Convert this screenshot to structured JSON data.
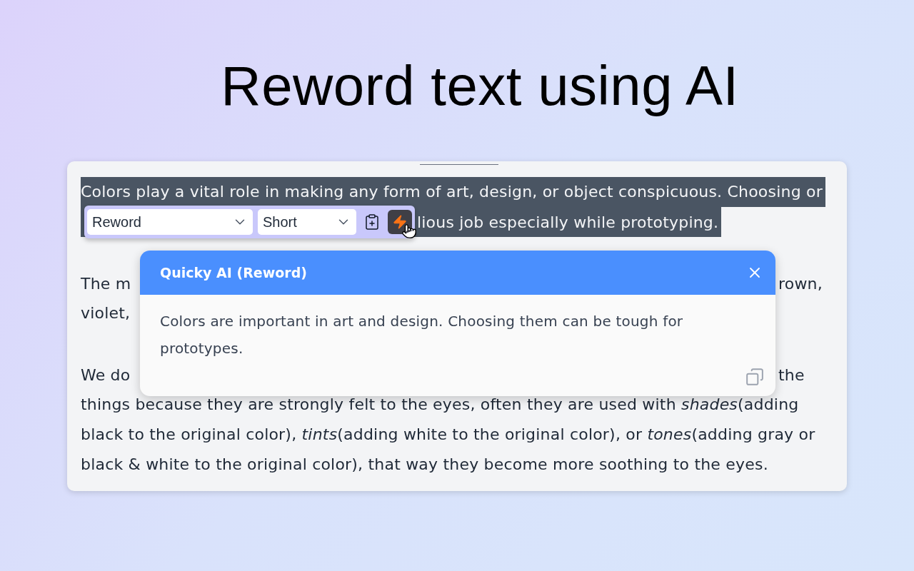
{
  "heading": "Reword text using AI",
  "editor": {
    "paragraphs": [
      {
        "selected": true,
        "lines": [
          {
            "left": "Colors play a vital role in making any form of art, design, or object conspicuous. Choosing or"
          },
          {
            "right": "lious job especially while prototyping."
          }
        ]
      },
      {
        "selected": false,
        "lines": [
          {
            "left": "The m",
            "right": "rown,"
          },
          {
            "left": "violet,"
          }
        ]
      },
      {
        "selected": false,
        "lines": [
          {
            "left": "We do",
            "right": "the"
          },
          {
            "left": "things because they are strongly felt to the eyes, often they are used with *shades*(adding"
          },
          {
            "left": "black to the original color), *tints*(adding white to the original color), or *tones*(adding gray or"
          },
          {
            "left": "black & white to the original color), that way they become more soothing to the eyes."
          }
        ]
      }
    ]
  },
  "toolbar": {
    "action_select": {
      "value": "Reword"
    },
    "length_select": {
      "value": "Short"
    }
  },
  "popup": {
    "title": "Quicky AI (Reword)",
    "text": "Colors are important in art and design. Choosing them can be tough for prototypes."
  }
}
